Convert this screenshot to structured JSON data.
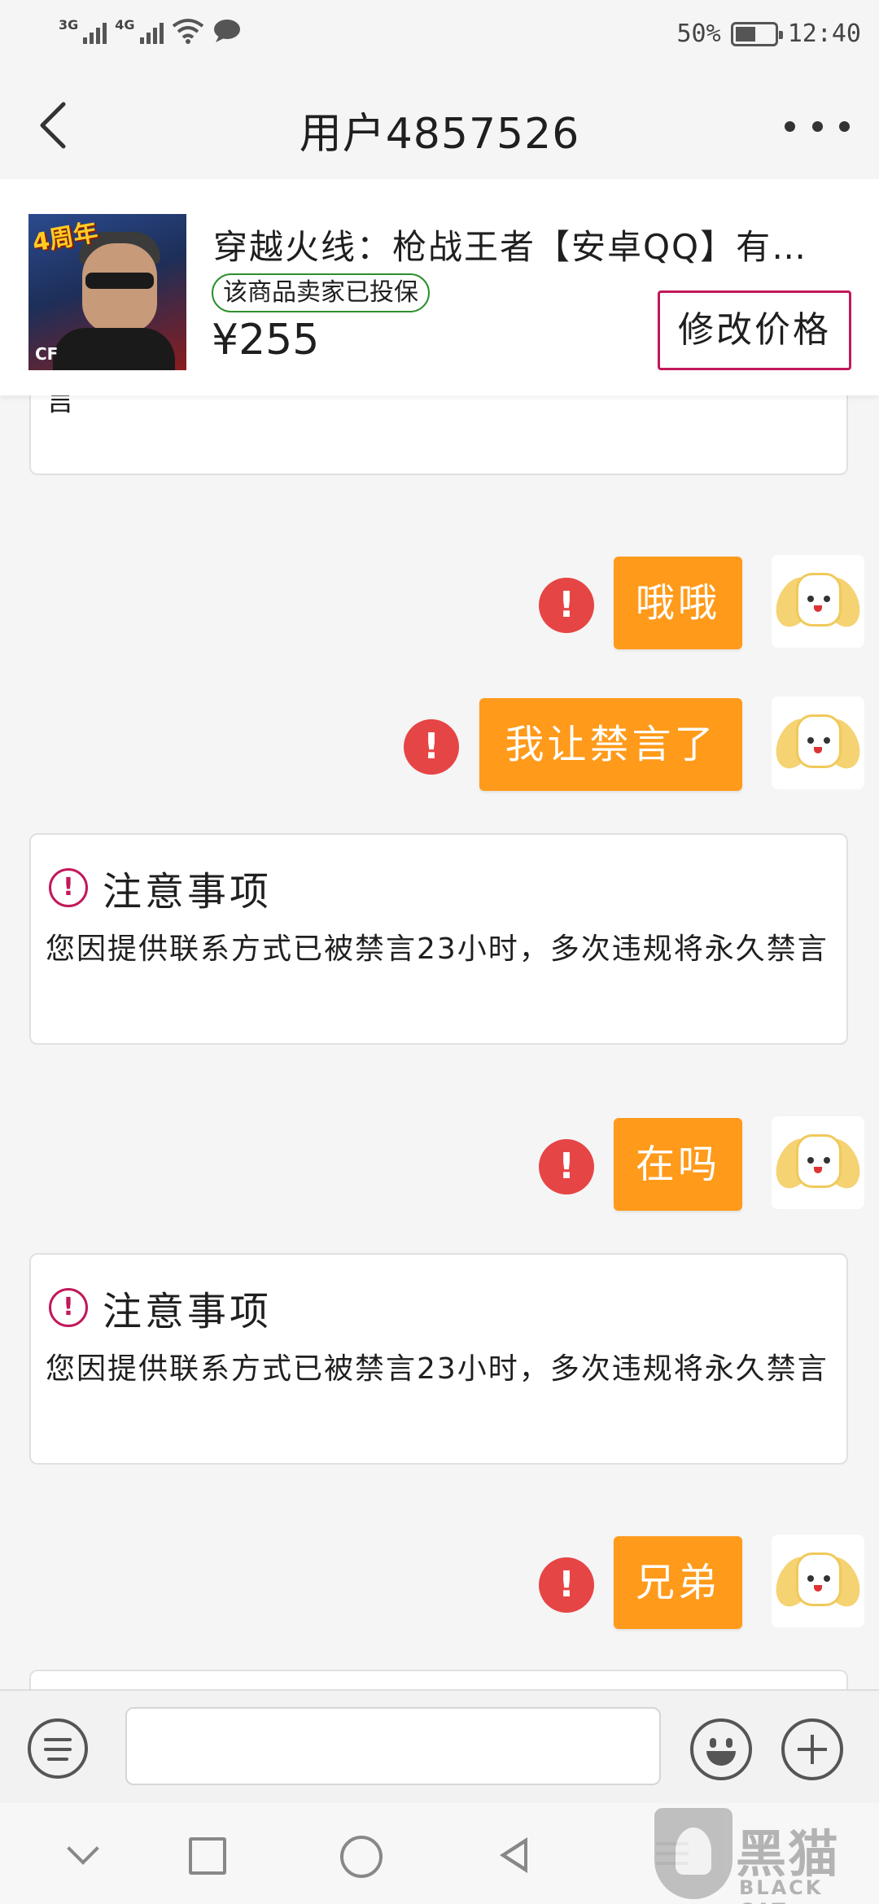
{
  "status_bar": {
    "network_1": "3G",
    "network_2": "4G",
    "battery": "50%",
    "time": "12:40"
  },
  "nav": {
    "title": "用户4857526"
  },
  "product": {
    "title": "穿越火线：枪战王者【安卓QQ】有…",
    "thumb_badge": "4周年",
    "thumb_logo": "CF",
    "insured_label": "该商品卖家已投保",
    "price": "¥255",
    "edit_price_label": "修改价格"
  },
  "chat": {
    "notice_partial_tail": "言",
    "notices": [
      {
        "title": "注意事项",
        "body": "您因提供联系方式已被禁言23小时，多次违规将永久禁言"
      },
      {
        "title": "注意事项",
        "body": "您因提供联系方式已被禁言23小时，多次违规将永久禁言"
      }
    ],
    "messages": [
      {
        "text": "哦哦",
        "status": "failed"
      },
      {
        "text": "我让禁言了",
        "status": "failed"
      },
      {
        "text": "在吗",
        "status": "failed"
      },
      {
        "text": "兄弟",
        "status": "failed"
      }
    ],
    "error_glyph": "!",
    "notice_glyph": "!"
  },
  "input_bar": {
    "left_icon": "menu-lines-icon",
    "message_value": "",
    "emoji_icon": "smile-icon",
    "plus_icon": "plus-icon"
  },
  "watermark": {
    "cn": "黑猫",
    "en": "BLACK CAT"
  },
  "colors": {
    "bubble": "#ff9a1a",
    "error": "#e64545",
    "accent": "#c2185b",
    "insured_border": "#2d8f2d"
  }
}
